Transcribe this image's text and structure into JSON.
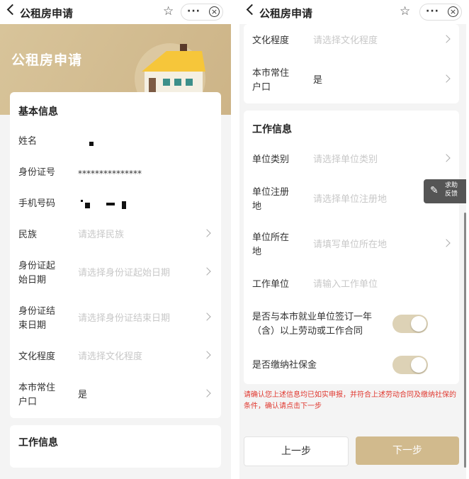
{
  "app": {
    "title": "公租房申请"
  },
  "banner": {
    "title": "公租房申请"
  },
  "basic_info": {
    "section_title": "基本信息",
    "name_label": "姓名",
    "id_label": "身份证号",
    "id_value": "***************",
    "phone_label": "手机号码",
    "ethnicity_label": "民族",
    "ethnicity_placeholder": "请选择民族",
    "id_start_label_1": "身份证起",
    "id_start_label_2": "始日期",
    "id_start_placeholder": "请选择身份证起始日期",
    "id_end_label_1": "身份证结",
    "id_end_label_2": "束日期",
    "id_end_placeholder": "请选择身份证结束日期",
    "education_label": "文化程度",
    "education_placeholder": "请选择文化程度",
    "hukou_label_1": "本市常住",
    "hukou_label_2": "户口",
    "hukou_value": "是"
  },
  "work_info": {
    "section_title": "工作信息",
    "unit_type_label": "单位类别",
    "unit_type_placeholder": "请选择单位类别",
    "unit_reg_label_1": "单位注册",
    "unit_reg_label_2": "地",
    "unit_reg_placeholder": "请选择单位注册地",
    "unit_loc_label_1": "单位所在",
    "unit_loc_label_2": "地",
    "unit_loc_placeholder": "请填写单位所在地",
    "employer_label": "工作单位",
    "employer_placeholder": "请输入工作单位",
    "contract_label_1": "是否与本市就业单位签订一年",
    "contract_label_2": "（含）以上劳动或工作合同",
    "social_label": "是否缴纳社保金"
  },
  "notice": "请确认您上述信息均已如实申报，并符合上述劳动合同及缴纳社保的条件，确认请点击下一步",
  "buttons": {
    "prev": "上一步",
    "next": "下一步"
  },
  "feedback": {
    "line1": "求助",
    "line2": "反馈"
  },
  "toggles": {
    "contract_on": true,
    "social_on": true
  },
  "colors": {
    "accent": "#d1ba8d",
    "notice": "#e0382f",
    "banner": "#d8c49a"
  },
  "icons": [
    "back-icon",
    "star-icon",
    "more-icon",
    "close-icon",
    "chevron-right-icon",
    "pen-icon",
    "house-illustration"
  ]
}
